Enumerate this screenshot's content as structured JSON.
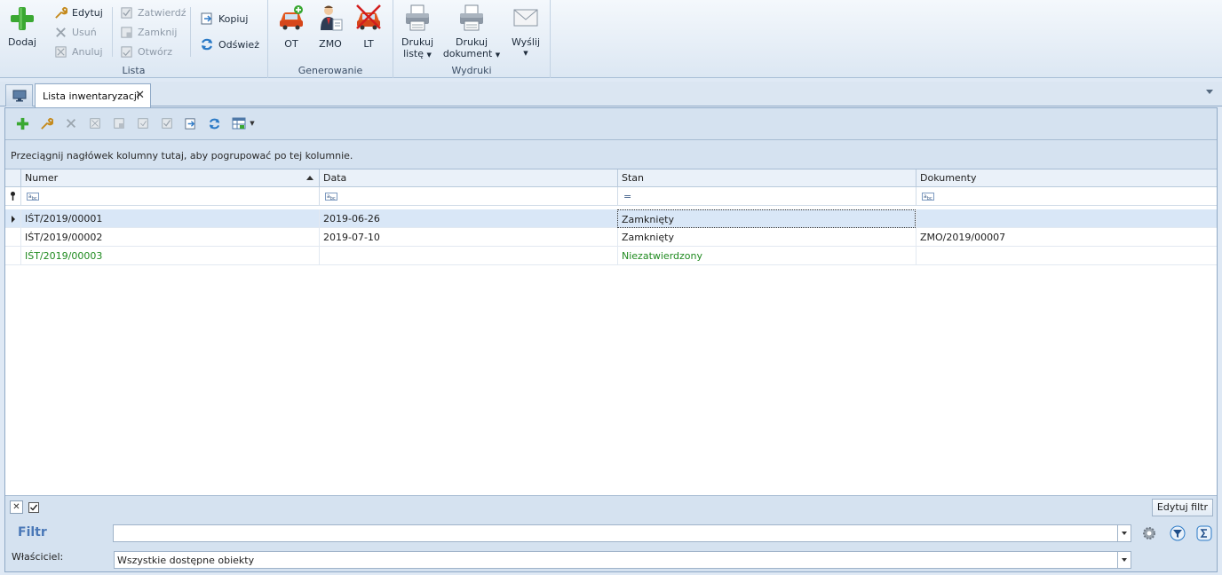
{
  "ribbon": {
    "lista": {
      "label": "Lista",
      "add": "Dodaj",
      "edit": "Edytuj",
      "delete": "Usuń",
      "cancel": "Anuluj",
      "approve": "Zatwierdź",
      "close": "Zamknij",
      "open": "Otwórz",
      "copy": "Kopiuj",
      "refresh": "Odśwież"
    },
    "generowanie": {
      "label": "Generowanie",
      "ot": "OT",
      "zmo": "ZMO",
      "lt": "LT"
    },
    "wydruki": {
      "label": "Wydruki",
      "print_list_1": "Drukuj",
      "print_list_2": "listę",
      "print_doc_1": "Drukuj",
      "print_doc_2": "dokument",
      "send": "Wyślij"
    }
  },
  "tab": {
    "title": "Lista inwentaryzacji"
  },
  "grid": {
    "group_hint": "Przeciągnij nagłówek kolumny tutaj, aby pogrupować po tej kolumnie.",
    "columns": [
      "Numer",
      "Data",
      "Stan",
      "Dokumenty"
    ],
    "rows": [
      {
        "numer": "IŚT/2019/00001",
        "data": "2019-06-26",
        "stan": "Zamknięty",
        "dokumenty": ""
      },
      {
        "numer": "IŚT/2019/00002",
        "data": "2019-07-10",
        "stan": "Zamknięty",
        "dokumenty": "ZMO/2019/00007"
      },
      {
        "numer": "IŚT/2019/00003",
        "data": "",
        "stan": "Niezatwierdzony",
        "dokumenty": ""
      }
    ]
  },
  "footer": {
    "edit_filter": "Edytuj filtr",
    "filter_label": "Filtr",
    "filter_value": "",
    "owner_label": "Właściciel:",
    "owner_value": "Wszystkie dostępne obiekty"
  },
  "colors": {
    "accent": "#4a78b7",
    "draft_row": "#1f8a1f",
    "selected_row": "#d9e7f7"
  }
}
